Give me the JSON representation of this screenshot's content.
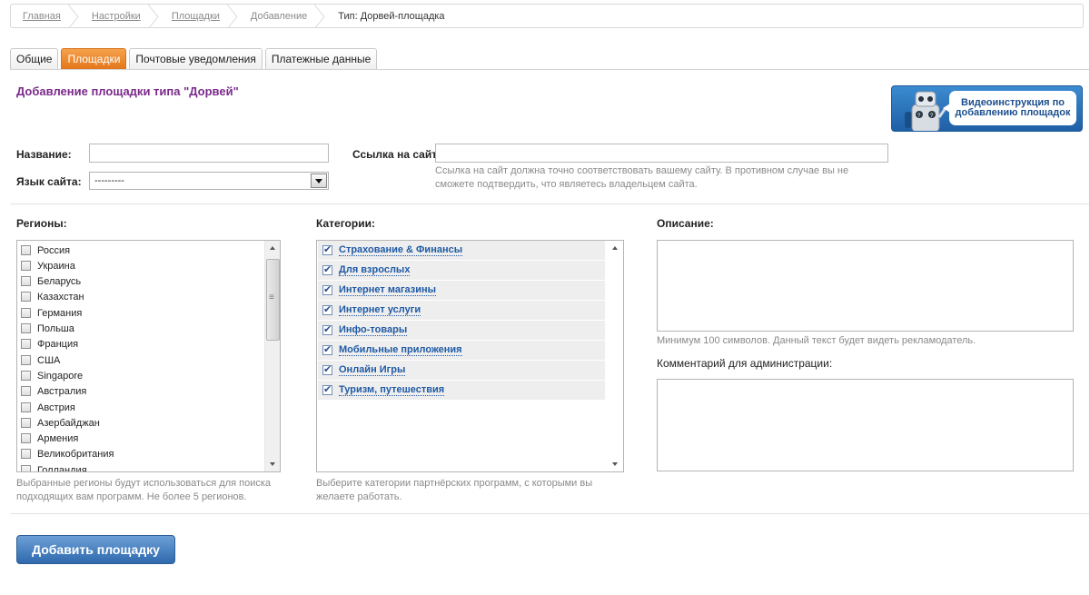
{
  "breadcrumb": [
    "Главная",
    "Настройки",
    "Площадки",
    "Добавление",
    "Тип: Дорвей-площадка"
  ],
  "tabs": [
    "Общие",
    "Площадки",
    "Почтовые уведомления",
    "Платежные данные"
  ],
  "active_tab": "Площадки",
  "page_title": "Добавление площадки типа \"Дорвей\"",
  "video": {
    "label": "Видеоинструкция по добавлению площадок",
    "icon": "robot-icon"
  },
  "form": {
    "name_label": "Название:",
    "name_value": "",
    "language_label": "Язык сайта:",
    "language_value": "---------",
    "url_label": "Ссылка на сайт:",
    "url_value": "",
    "url_hint": "Ссылка на сайт должна точно соответствовать вашему сайту. В противном случае вы не сможете подтвердить, что являетесь владельцем сайта."
  },
  "regions": {
    "title": "Регионы:",
    "items": [
      "Россия",
      "Украина",
      "Беларусь",
      "Казахстан",
      "Германия",
      "Польша",
      "Франция",
      "США",
      "Singapore",
      "Австралия",
      "Австрия",
      "Азербайджан",
      "Армения",
      "Великобритания",
      "Голландия"
    ],
    "hint": "Выбранные регионы будут использоваться для поиска подходящих вам программ. Не более 5 регионов."
  },
  "categories": {
    "title": "Категории:",
    "items": [
      "Страхование & Финансы",
      "Для взрослых",
      "Интернет магазины",
      "Интернет услуги",
      "Инфо-товары",
      "Мобильные приложения",
      "Онлайн Игры",
      "Туризм, путешествия"
    ],
    "hint": "Выберите категории партнёрских программ, с которыми вы желаете работать."
  },
  "description": {
    "title": "Описание:",
    "value": "",
    "hint": "Минимум 100 символов. Данный текст будет видеть рекламодатель."
  },
  "admin_comment": {
    "label": "Комментарий для администрации:",
    "value": ""
  },
  "submit_label": "Добавить площадку",
  "colors": {
    "accent": "#e4761b",
    "title": "#7a2a8a",
    "link": "#1f5aa5",
    "button": "#2f6aad"
  }
}
